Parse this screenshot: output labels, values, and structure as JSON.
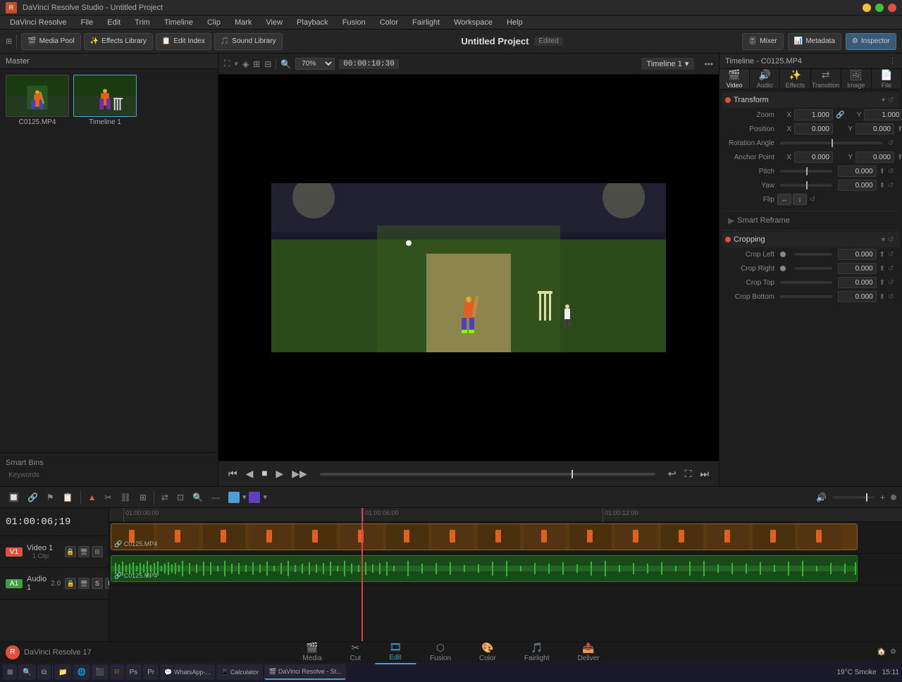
{
  "window": {
    "title": "DaVinci Resolve Studio - Untitled Project"
  },
  "menubar": {
    "items": [
      "DaVinci Resolve",
      "File",
      "Edit",
      "Trim",
      "Timeline",
      "Clip",
      "Mark",
      "View",
      "Playback",
      "Fusion",
      "Color",
      "Fairlight",
      "Workspace",
      "Help"
    ]
  },
  "toolbar": {
    "media_pool": "Media Pool",
    "effects_library": "Effects Library",
    "edit_index": "Edit Index",
    "sound_library": "Sound Library",
    "project_title": "Untitled Project",
    "edited_label": "Edited",
    "zoom": "70%",
    "timecode": "00:00:10:30",
    "timeline_name": "Timeline 1",
    "mixer_label": "Mixer",
    "metadata_label": "Metadata",
    "inspector_label": "Inspector"
  },
  "media_pool": {
    "header": "Master",
    "clips": [
      {
        "name": "C0125.MP4",
        "selected": false
      },
      {
        "name": "Timeline 1",
        "selected": true
      }
    ],
    "smart_bins": "Smart Bins",
    "keywords": "Keywords"
  },
  "preview": {
    "zoom": "70%",
    "timecode": "00:00:10:30",
    "timeline": "Timeline 1",
    "playhead_timecode": "01:00:06;19"
  },
  "inspector": {
    "header": "Timeline - C0125.MP4",
    "tabs": [
      "Video",
      "Audio",
      "Effects",
      "Transition",
      "Image",
      "File"
    ],
    "transform": {
      "title": "Transform",
      "zoom": {
        "label": "Zoom",
        "x_label": "X",
        "x_val": "1.000",
        "y_label": "Y",
        "y_val": "1.000"
      },
      "position": {
        "label": "Position",
        "x_label": "X",
        "x_val": "0.000",
        "y_label": "Y",
        "y_val": "0.000"
      },
      "rotation": {
        "label": "Rotation Angle",
        "val": ""
      },
      "anchor": {
        "label": "Anchor Point",
        "x_label": "X",
        "x_val": "0.000",
        "y_label": "Y",
        "y_val": "0.000"
      },
      "pitch": {
        "label": "Pitch",
        "val": "0.000"
      },
      "yaw": {
        "label": "Yaw",
        "val": "0.000"
      },
      "flip": {
        "label": "Flip"
      }
    },
    "smart_reframe": "Smart Reframe",
    "cropping": {
      "title": "Cropping",
      "crop_left": {
        "label": "Crop Left",
        "val": "0.000"
      },
      "crop_right": {
        "label": "Crop Right",
        "val": "0.000"
      },
      "crop_top": {
        "label": "Crop Top",
        "val": "0.000"
      },
      "crop_bottom": {
        "label": "Crop Bottom",
        "val": "0.000"
      }
    }
  },
  "timeline": {
    "timecode": "01:00:06;19",
    "tracks": [
      {
        "id": "V1",
        "name": "Video 1",
        "type": "video",
        "clip_label": "1 Clip",
        "clip_name": "C0125.MP4"
      },
      {
        "id": "A1",
        "name": "Audio 1",
        "type": "audio",
        "num": "2.0",
        "clip_name": "C0125.MP4"
      }
    ],
    "ruler_marks": [
      "01:00:00:00",
      "01:00:06:00",
      "01:00:12:00"
    ]
  },
  "page_tabs": [
    {
      "label": "Media",
      "icon": "🎬"
    },
    {
      "label": "Cut",
      "icon": "✂️"
    },
    {
      "label": "Edit",
      "icon": "🎞️",
      "active": true
    },
    {
      "label": "Fusion",
      "icon": "⬡"
    },
    {
      "label": "Color",
      "icon": "🎨"
    },
    {
      "label": "Fairlight",
      "icon": "🎵"
    },
    {
      "label": "Deliver",
      "icon": "📤"
    }
  ],
  "resolve": {
    "version": "DaVinci Resolve 17"
  },
  "taskbar": {
    "time": "15:11",
    "date": "19°C",
    "weather": "Smoke"
  }
}
